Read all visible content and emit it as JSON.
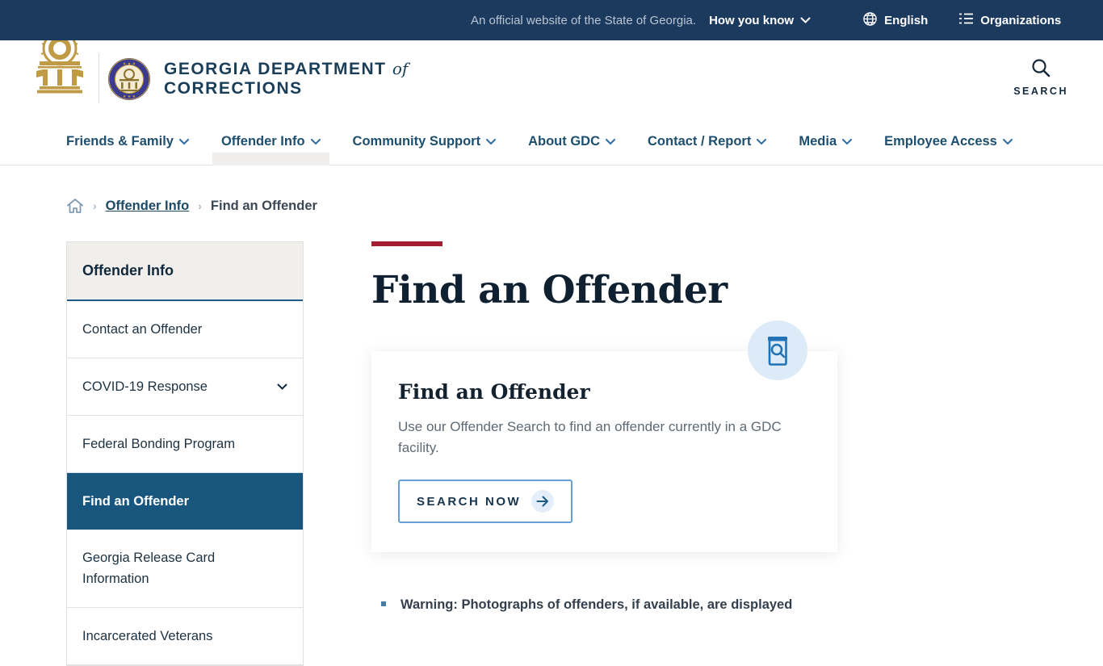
{
  "official_bar": {
    "message": "An official website of the State of Georgia.",
    "how_you_know": "How you know",
    "language": "English",
    "organizations": "Organizations"
  },
  "header": {
    "agency_line1": "GEORGIA DEPARTMENT",
    "agency_of": "of",
    "agency_line2": "CORRECTIONS",
    "search_label": "SEARCH"
  },
  "nav": {
    "items": [
      {
        "label": "Friends & Family",
        "active": false
      },
      {
        "label": "Offender Info",
        "active": true
      },
      {
        "label": "Community Support",
        "active": false
      },
      {
        "label": "About GDC",
        "active": false
      },
      {
        "label": "Contact / Report",
        "active": false
      },
      {
        "label": "Media",
        "active": false
      },
      {
        "label": "Employee Access",
        "active": false
      }
    ]
  },
  "breadcrumb": {
    "items": [
      "Offender Info",
      "Find an Offender"
    ]
  },
  "sidebar": {
    "title": "Offender Info",
    "items": [
      {
        "label": "Contact an Offender",
        "active": false,
        "has_children": false
      },
      {
        "label": "COVID-19 Response",
        "active": false,
        "has_children": true
      },
      {
        "label": "Federal Bonding Program",
        "active": false,
        "has_children": false
      },
      {
        "label": "Find an Offender",
        "active": true,
        "has_children": false
      },
      {
        "label": "Georgia Release Card Information",
        "active": false,
        "has_children": false
      },
      {
        "label": "Incarcerated Veterans",
        "active": false,
        "has_children": false
      }
    ]
  },
  "main": {
    "title": "Find an Offender",
    "card": {
      "title": "Find an Offender",
      "body": "Use our Offender Search to find an offender currently in a GDC facility.",
      "button_label": "SEARCH NOW"
    },
    "warning": "Warning: Photographs of offenders, if available, are displayed"
  },
  "colors": {
    "topbar_navy": "#1c3a5e",
    "nav_link_blue": "#1e4f6e",
    "active_item_blue": "#19567e",
    "accent_red": "#a41e31",
    "icon_blue": "#2273b5",
    "icon_circle_bg": "#ddeaf7",
    "gold": "#bf9b45"
  }
}
